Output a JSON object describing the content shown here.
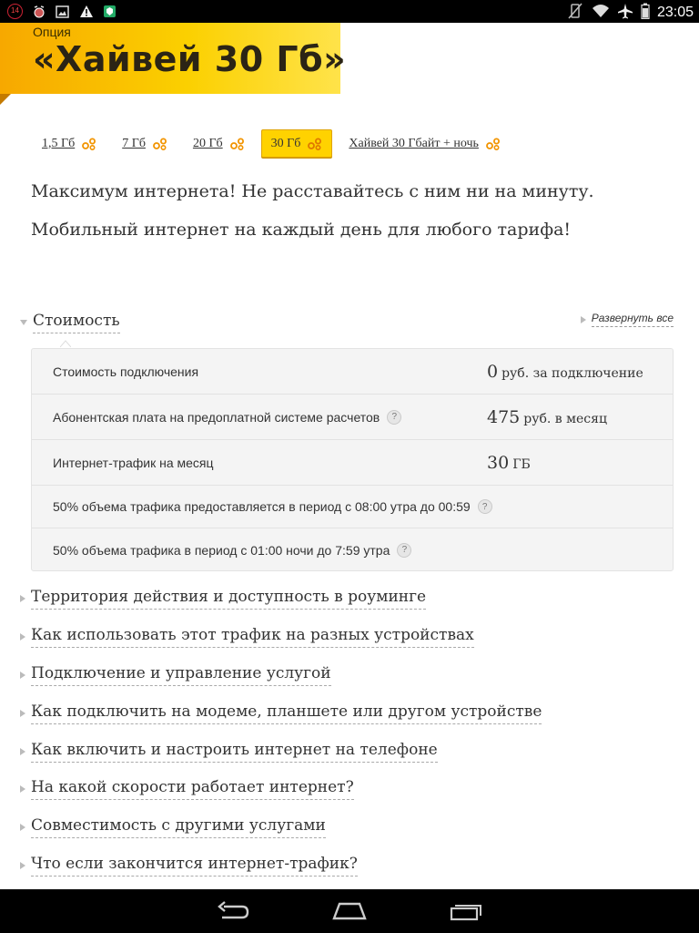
{
  "status_bar": {
    "notification_count": "14",
    "time": "23:05",
    "icons_left": [
      "notification-count-badge",
      "alarm-clock-icon",
      "gallery-icon",
      "warning-icon",
      "security-app-icon"
    ],
    "icons_right": [
      "vibrate-off-icon",
      "wifi-icon",
      "airplane-mode-icon",
      "battery-icon"
    ]
  },
  "header": {
    "label": "Опция",
    "title": "«Хайвей 30 Гб»"
  },
  "tabs": [
    {
      "label": "1,5 Гб",
      "active": false
    },
    {
      "label": "7 Гб",
      "active": false
    },
    {
      "label": "20 Гб",
      "active": false
    },
    {
      "label": "30 Гб",
      "active": true
    },
    {
      "label": "Хайвей 30 Гбайт + ночь",
      "active": false
    }
  ],
  "lead": {
    "line1": "Максимум интернета! Не расставайтесь с ним ни на минуту.",
    "line2": "Мобильный интернет на каждый день для любого тарифа!"
  },
  "expand_all": "Развернуть все",
  "cost_section": {
    "title": "Стоимость",
    "rows": [
      {
        "label": "Стоимость подключения",
        "value": "0",
        "unit": "руб. за подключение",
        "help": false
      },
      {
        "label": "Абонентская плата на предоплатной системе расчетов",
        "value": "475",
        "unit": "руб. в месяц",
        "help": true
      },
      {
        "label": "Интернет-трафик на месяц",
        "value": "30",
        "unit": "ГБ",
        "help": false
      },
      {
        "label": "50% объема трафика предоставляется в период с 08:00 утра до 00:59",
        "value": "",
        "unit": "",
        "help": true
      },
      {
        "label": "50% объема трафика в период с 01:00 ночи до 7:59 утра",
        "value": "",
        "unit": "",
        "help": true
      }
    ]
  },
  "sections": [
    "Территория действия и доступность в роуминге",
    "Как использовать этот трафик на разных устройствах",
    "Подключение и управление услугой",
    "Как подключить на модеме, планшете или другом устройстве",
    "Как включить и настроить интернет на телефоне",
    "На какой скорости работает интернет?",
    "Совместимость с другими услугами",
    "Что если закончится интернет-трафик?"
  ],
  "help_glyph": "?",
  "nav": [
    "back-button",
    "home-button",
    "recent-apps-button"
  ],
  "colors": {
    "accent": "#ffd200",
    "accent_border": "#e0a400",
    "header_gradient_start": "#f7a800"
  }
}
